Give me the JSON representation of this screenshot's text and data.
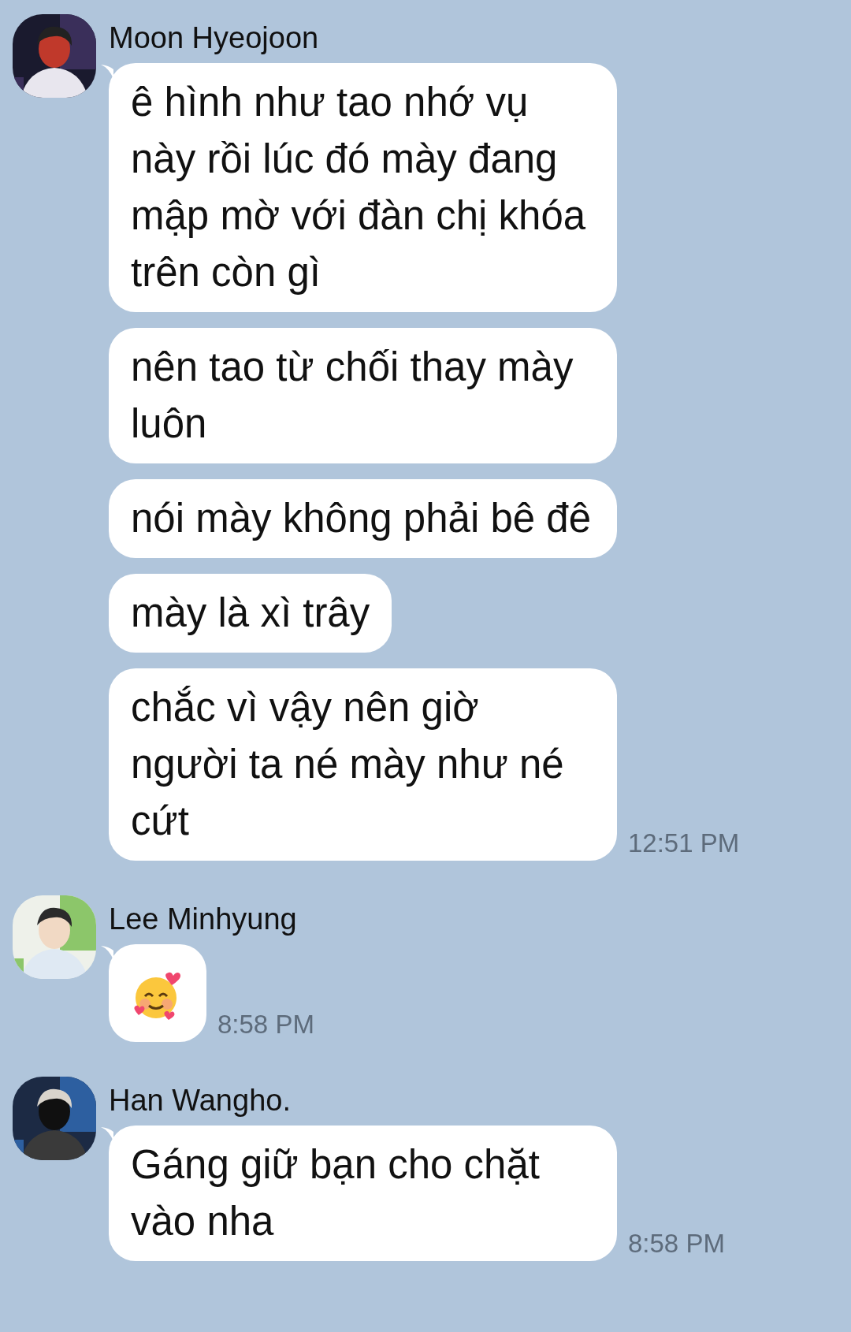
{
  "groups": [
    {
      "sender": "Moon Hyeojoon",
      "time": "12:51 PM",
      "messages": [
        {
          "kind": "text",
          "text": "ê hình như tao nhớ vụ này rồi lúc đó mày đang mập mờ với đàn chị khóa trên còn gì"
        },
        {
          "kind": "text",
          "text": "nên tao từ chối thay mày luôn"
        },
        {
          "kind": "text",
          "text": "nói mày không phải bê đê"
        },
        {
          "kind": "text",
          "text": "mày là xì trây"
        },
        {
          "kind": "text",
          "text": "chắc vì vậy nên giờ người ta né mày như né cứt"
        }
      ]
    },
    {
      "sender": "Lee Minhyung",
      "time": "8:58 PM",
      "messages": [
        {
          "kind": "emoji"
        }
      ]
    },
    {
      "sender": "Han Wangho.",
      "time": "8:58 PM",
      "messages": [
        {
          "kind": "text",
          "text": "Gáng giữ bạn cho chặt vào nha"
        }
      ]
    }
  ]
}
